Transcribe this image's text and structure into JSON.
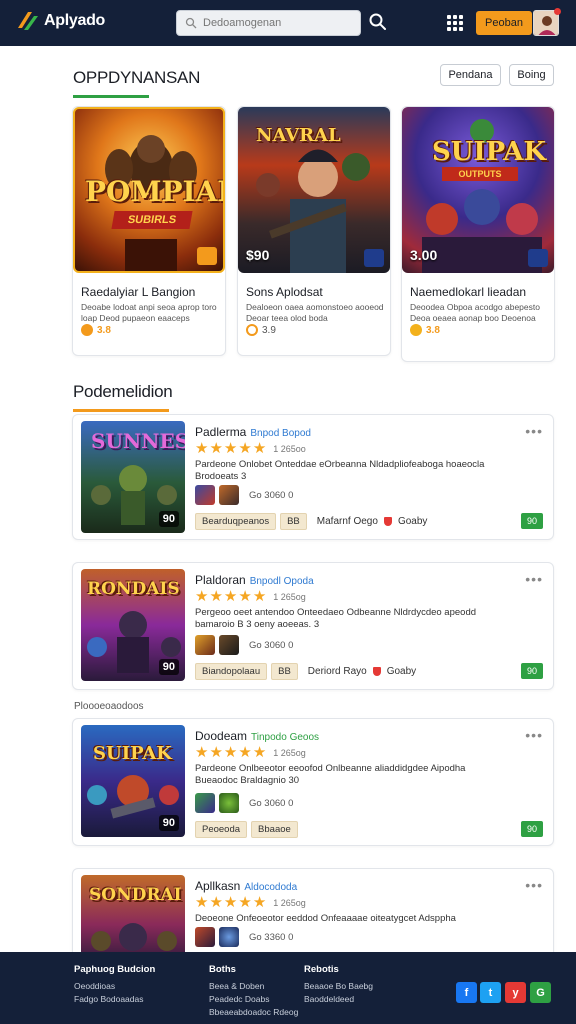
{
  "header": {
    "logo_text": "Aplyado",
    "search_placeholder": "Dedoamogenan",
    "login_label": "Peoban"
  },
  "featured": {
    "title": "OPPDYNANSAN",
    "filters": [
      "Pendana",
      "Boing"
    ],
    "cards": [
      {
        "art_title": "POMPIAN",
        "art_sub": "SUBIRLS",
        "price": "",
        "title": "Raedalyiar L Bangion",
        "desc": "Deoabe lodoat anpi seoa aprop toro loap Deod pupaeon eaaceps",
        "rating": "3.8"
      },
      {
        "art_title": "NAVRAL",
        "art_sub": "",
        "price": "$90",
        "title": "Sons Aplodsat",
        "desc": "Dealoeon oaea aomonstoeo aooeod Deoar teea olod boda",
        "rating": "3.9"
      },
      {
        "art_title": "SUIPAK",
        "art_sub": "OUTPUTS",
        "price": "3.00",
        "title": "Naemedlokarl lieadan",
        "desc": "Deoodea Obpoa acodgo abepesto Deoa oeaea aonap boo Deoenoa",
        "rating": "3.8"
      }
    ]
  },
  "popular": {
    "title": "Podemelidion",
    "divider_label": "Ploooeoaodoos",
    "items": [
      {
        "name": "Padlerma",
        "dev": "Bnpod Bopod",
        "rating_count": "1 265oo",
        "desc": "Pardeone Onlobet Onteddae eOrbeanna Nldadpliofeaboga hoaeocla Brodoeats 3",
        "meta": "Go 3060 0",
        "tags": [
          "Bearduqpeanos",
          "BB"
        ],
        "platform": "Mafarnf Oego",
        "store": "Goaby",
        "thumb_num": "90",
        "dl": "90",
        "art": "SUNNES"
      },
      {
        "name": "Plaldoran",
        "dev": "Bnpodl Opoda",
        "rating_count": "1 265og",
        "desc": "Pergeoo oeet antendoo Onteedaeo Odbeanne Nldrdycdeo apeodd bamaroio B 3 oeny aoeeas. 3",
        "meta": "Go 3060 0",
        "tags": [
          "Biandopolaau",
          "BB"
        ],
        "platform": "Deriord Rayo",
        "store": "Goaby",
        "thumb_num": "90",
        "dl": "90",
        "art": "RONDAIS"
      },
      {
        "name": "Doodeam",
        "dev": "Tinpodo Geoos",
        "rating_count": "1 265og",
        "desc": "Pardeone Onlbeeotor eeoofod Onlbeanne aliaddidgdee Aipodha Bueaodoc Braldagnio 30",
        "meta": "Go 3060 0",
        "tags": [
          "Peoeoda",
          "Bbaaoe"
        ],
        "platform": "",
        "store": "",
        "thumb_num": "90",
        "dl": "90",
        "art": "SUIPAK"
      },
      {
        "name": "Apllkasn",
        "dev": "Aldocododa",
        "rating_count": "1 265og",
        "desc": "Deoeone Onfeoeotor eeddod Onfeaaaae oiteatygcet Adsppha",
        "meta": "Go 3360 0",
        "tags": [],
        "platform": "",
        "store": "",
        "thumb_num": "",
        "dl": "",
        "art": "SONDRAI"
      }
    ]
  },
  "footer": {
    "col1": {
      "heading": "Paphuog Budcion",
      "links": [
        "Oeoddioas",
        "Fadgo Bodoaadas"
      ]
    },
    "col2": {
      "heading": "Boths",
      "links": [
        "Beea & Doben",
        "Peadedc Doabs",
        "Bbeaeabdoadoc Rdeog"
      ]
    },
    "col3": {
      "heading": "Rebotis",
      "links": [
        "Beaaoe Bo Baebg",
        "Baoddeldeed"
      ]
    },
    "social": [
      "f",
      "t",
      "y",
      "G"
    ]
  },
  "colors": {
    "topbar": "#142039",
    "accent_orange": "#f39a1c",
    "accent_green": "#2ea043",
    "link_blue": "#2f7ad1",
    "star": "#f5a623"
  }
}
